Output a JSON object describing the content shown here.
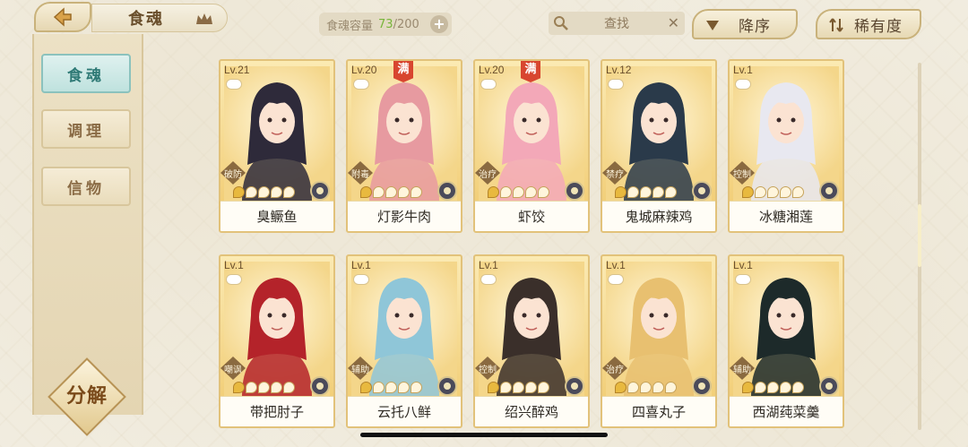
{
  "header": {
    "title": "食魂",
    "capacity_label": "食魂容量",
    "capacity_used": "73",
    "capacity_sep": "/",
    "capacity_total": "200",
    "search_label": "查找",
    "sort_label": "降序",
    "rarity_label": "稀有度"
  },
  "sidebar": {
    "tabs": [
      {
        "label": "食魂",
        "active": true
      },
      {
        "label": "调理",
        "active": false
      },
      {
        "label": "信物",
        "active": false
      }
    ],
    "decompose_label": "分解"
  },
  "cards": [
    {
      "level": "Lv.21",
      "name": "臭鳜鱼",
      "role": "破防",
      "full": false,
      "full_label": "",
      "stars": 1
    },
    {
      "level": "Lv.20",
      "name": "灯影牛肉",
      "role": "附毒",
      "full": true,
      "full_label": "满",
      "stars": 1
    },
    {
      "level": "Lv.20",
      "name": "虾饺",
      "role": "治疗",
      "full": true,
      "full_label": "满",
      "stars": 1
    },
    {
      "level": "Lv.12",
      "name": "鬼城麻辣鸡",
      "role": "禁疗",
      "full": false,
      "full_label": "",
      "stars": 1
    },
    {
      "level": "Lv.1",
      "name": "冰糖湘莲",
      "role": "控制",
      "full": false,
      "full_label": "",
      "stars": 1
    },
    {
      "level": "Lv.1",
      "name": "带把肘子",
      "role": "嘲讽",
      "full": false,
      "full_label": "",
      "stars": 1
    },
    {
      "level": "Lv.1",
      "name": "云托八鲜",
      "role": "辅助",
      "full": false,
      "full_label": "",
      "stars": 1
    },
    {
      "level": "Lv.1",
      "name": "绍兴醉鸡",
      "role": "控制",
      "full": false,
      "full_label": "",
      "stars": 1
    },
    {
      "level": "Lv.1",
      "name": "四喜丸子",
      "role": "治疗",
      "full": false,
      "full_label": "",
      "stars": 1
    },
    {
      "level": "Lv.1",
      "name": "西湖莼菜羹",
      "role": "辅助",
      "full": false,
      "full_label": "",
      "stars": 1
    }
  ],
  "colors": {
    "accent_green": "#78b53a",
    "active_tab": "#2f7a76",
    "card_gold": "#f0c96d",
    "badge_red": "#d8462f"
  }
}
